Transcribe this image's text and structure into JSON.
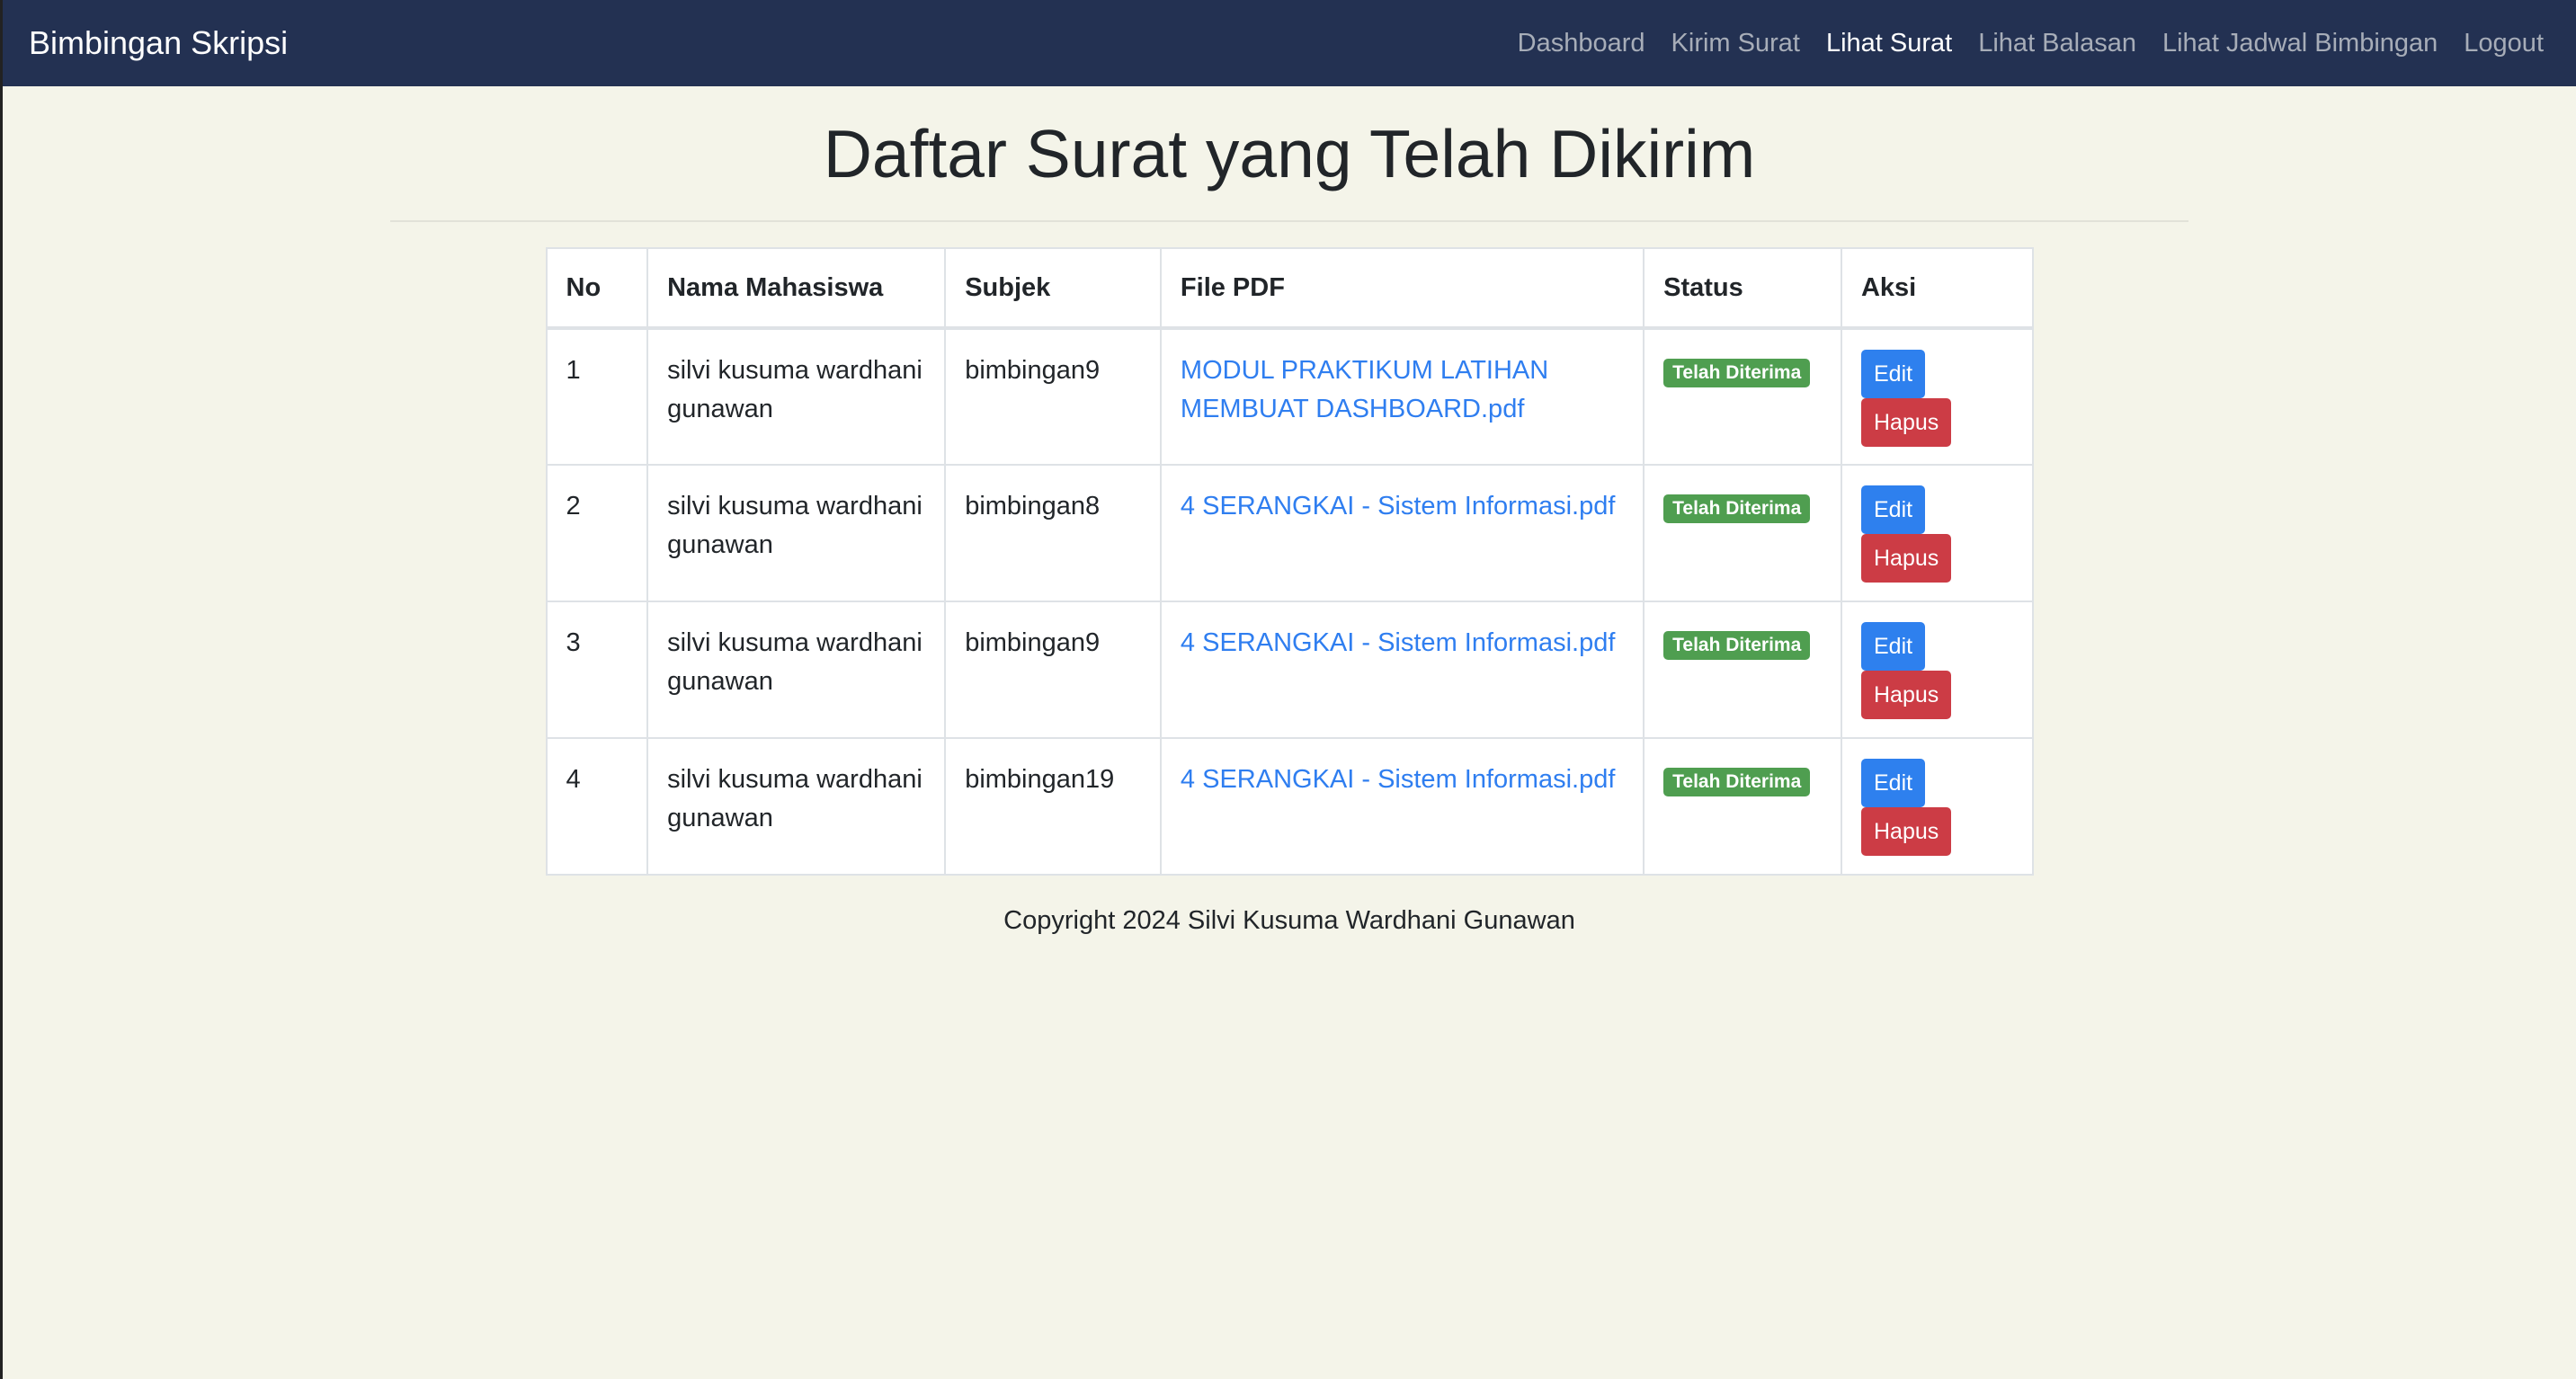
{
  "navbar": {
    "brand": "Bimbingan Skripsi",
    "links": [
      {
        "label": "Dashboard",
        "active": false
      },
      {
        "label": "Kirim Surat",
        "active": false
      },
      {
        "label": "Lihat Surat",
        "active": true
      },
      {
        "label": "Lihat Balasan",
        "active": false
      },
      {
        "label": "Lihat Jadwal Bimbingan",
        "active": false
      },
      {
        "label": "Logout",
        "active": false
      }
    ]
  },
  "page": {
    "title": "Daftar Surat yang Telah Dikirim"
  },
  "table": {
    "headers": [
      "No",
      "Nama Mahasiswa",
      "Subjek",
      "File PDF",
      "Status",
      "Aksi"
    ],
    "rows": [
      {
        "no": "1",
        "nama": "silvi kusuma wardhani gunawan",
        "subjek": "bimbingan9",
        "file": "MODUL PRAKTIKUM LATIHAN MEMBUAT DASHBOARD.pdf",
        "status": "Telah Diterima",
        "edit_label": "Edit",
        "hapus_label": "Hapus"
      },
      {
        "no": "2",
        "nama": "silvi kusuma wardhani gunawan",
        "subjek": "bimbingan8",
        "file": "4 SERANGKAI - Sistem Informasi.pdf",
        "status": "Telah Diterima",
        "edit_label": "Edit",
        "hapus_label": "Hapus"
      },
      {
        "no": "3",
        "nama": "silvi kusuma wardhani gunawan",
        "subjek": "bimbingan9",
        "file": "4 SERANGKAI - Sistem Informasi.pdf",
        "status": "Telah Diterima",
        "edit_label": "Edit",
        "hapus_label": "Hapus"
      },
      {
        "no": "4",
        "nama": "silvi kusuma wardhani gunawan",
        "subjek": "bimbingan19",
        "file": "4 SERANGKAI - Sistem Informasi.pdf",
        "status": "Telah Diterima",
        "edit_label": "Edit",
        "hapus_label": "Hapus"
      }
    ]
  },
  "footer": {
    "text": "Copyright 2024 Silvi Kusuma Wardhani Gunawan"
  },
  "colors": {
    "navbar_bg": "#233152",
    "page_bg": "#f4f4e9",
    "link": "#2f7ef0",
    "badge_success": "#4f9e50",
    "button_primary": "#2e80ee",
    "button_danger": "#cc3c45"
  }
}
